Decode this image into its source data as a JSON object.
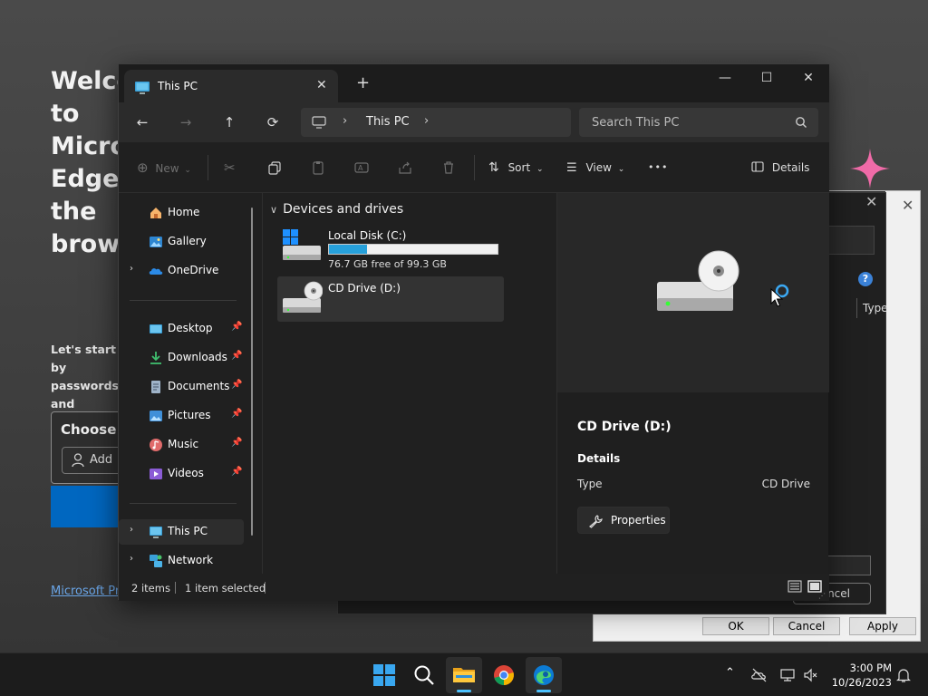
{
  "background": {
    "edge_heading": "Welcome to Microsoft\nEdge, the\nbrowser",
    "edge_subtext": "Let's start by\npasswords, and",
    "choose_title": "Choose a",
    "add_label": "Add",
    "link_text": "Microsoft Privacy"
  },
  "bg_dialog": {
    "type_col": "Type",
    "cancel_label": "ncel",
    "ok_label": "OK",
    "cancel2_label": "Cancel",
    "apply_label": "Apply",
    "help": "?"
  },
  "window": {
    "tab_title": "This PC",
    "new_tab": "+",
    "minimize": "—",
    "maximize": "☐",
    "close": "✕"
  },
  "address": {
    "crumb": "This PC",
    "search_placeholder": "Search This PC"
  },
  "commands": {
    "new": "New",
    "sort": "Sort",
    "view": "View",
    "more": "•••",
    "details": "Details"
  },
  "nav": {
    "items": [
      {
        "label": "Home",
        "icon": "home-icon"
      },
      {
        "label": "Gallery",
        "icon": "gallery-icon"
      },
      {
        "label": "OneDrive",
        "icon": "onedrive-icon"
      },
      {
        "label": "Desktop",
        "icon": "desktop-icon"
      },
      {
        "label": "Downloads",
        "icon": "downloads-icon"
      },
      {
        "label": "Documents",
        "icon": "documents-icon"
      },
      {
        "label": "Pictures",
        "icon": "pictures-icon"
      },
      {
        "label": "Music",
        "icon": "music-icon"
      },
      {
        "label": "Videos",
        "icon": "videos-icon"
      },
      {
        "label": "This PC",
        "icon": "this-pc-icon"
      },
      {
        "label": "Network",
        "icon": "network-icon"
      }
    ]
  },
  "content": {
    "group": "Devices and drives",
    "drives": [
      {
        "name": "Local Disk (C:)",
        "free": "76.7 GB free of 99.3 GB",
        "used_fraction": 0.228
      },
      {
        "name": "CD Drive (D:)"
      }
    ]
  },
  "details": {
    "name": "CD Drive (D:)",
    "section": "Details",
    "type_key": "Type",
    "type_value": "CD Drive",
    "properties": "Properties"
  },
  "status": {
    "count": "2 items",
    "selected": "1 item selected"
  },
  "taskbar": {
    "time": "3:00 PM",
    "date": "10/26/2023"
  },
  "colors": {
    "accent": "#4cc2ff",
    "drive_bar": "#26a0da",
    "edge_blue": "#0067c0"
  }
}
